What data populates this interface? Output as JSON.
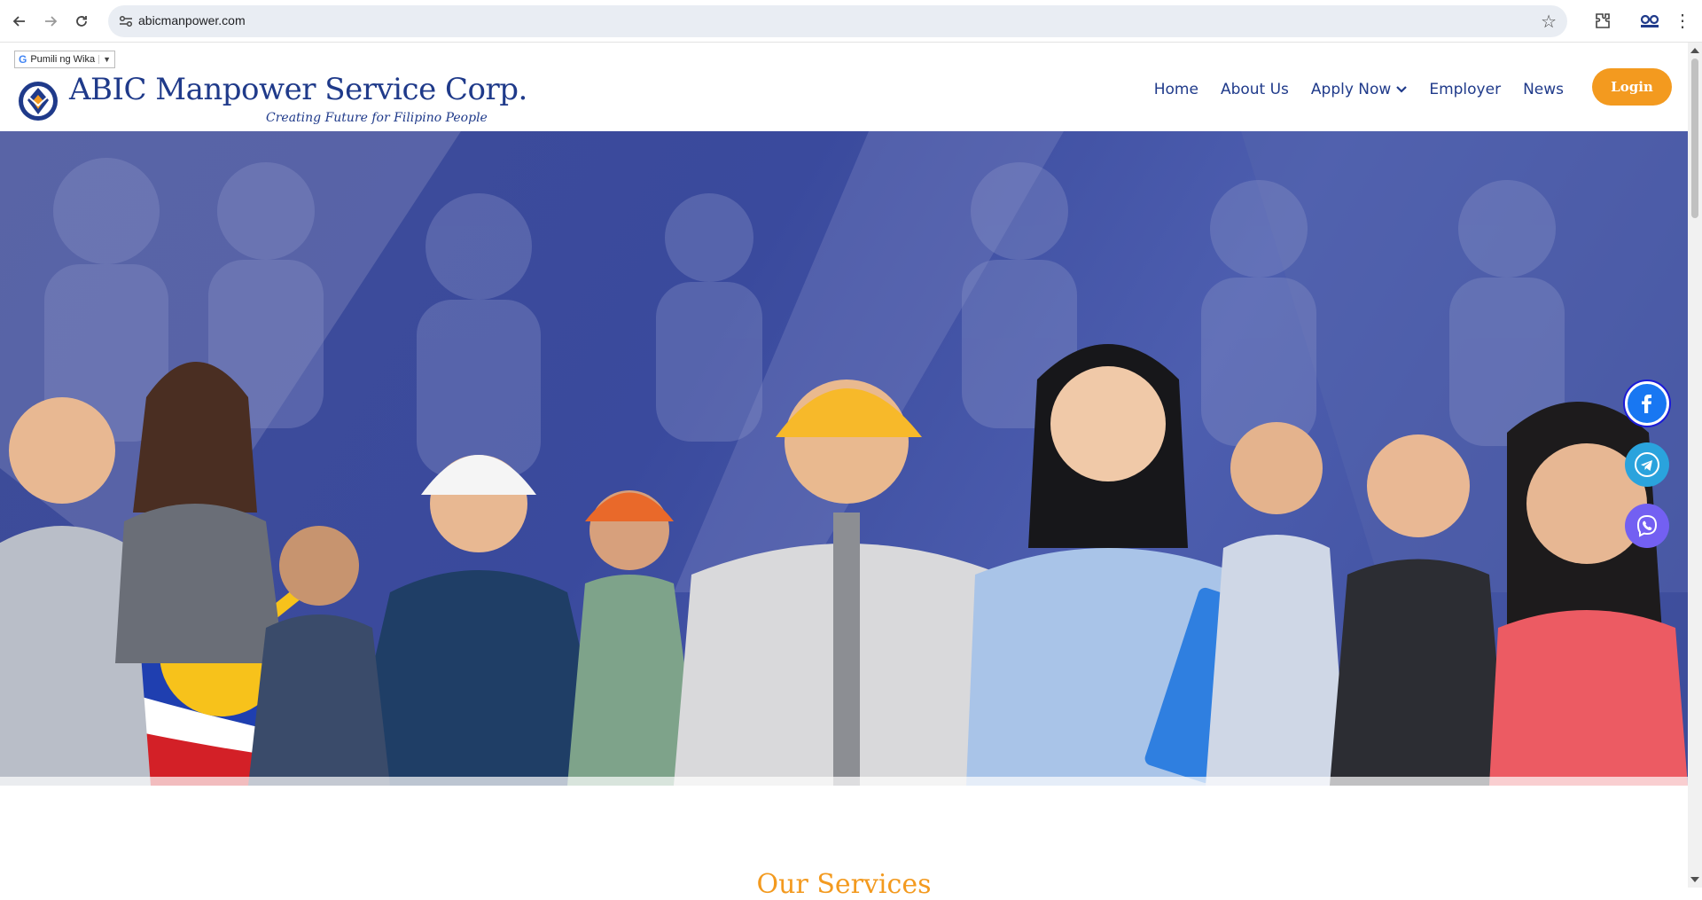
{
  "browser": {
    "url": "abicmanpower.com",
    "icons": [
      "back-icon",
      "forward-icon",
      "reload-icon",
      "site-info-icon",
      "star-icon",
      "extensions-icon",
      "profile-icon",
      "menu-icon"
    ]
  },
  "translate_widget": {
    "label": "Pumili ng Wika",
    "caret": "▼"
  },
  "header": {
    "brand": "ABIC Manpower Service Corp.",
    "tagline": "Creating Future for Filipino People",
    "nav": [
      "Home",
      "About Us",
      "Apply Now",
      "Employer",
      "News"
    ],
    "login_label": "Login"
  },
  "hero": {
    "description": ""
  },
  "services": {
    "title": "Our Services"
  },
  "social": [
    "facebook-icon",
    "telegram-icon",
    "viber-icon"
  ],
  "colors": {
    "brand_blue": "#1f3a8a",
    "accent_orange": "#f39a1f",
    "hero_blue": "#3e4c98"
  }
}
